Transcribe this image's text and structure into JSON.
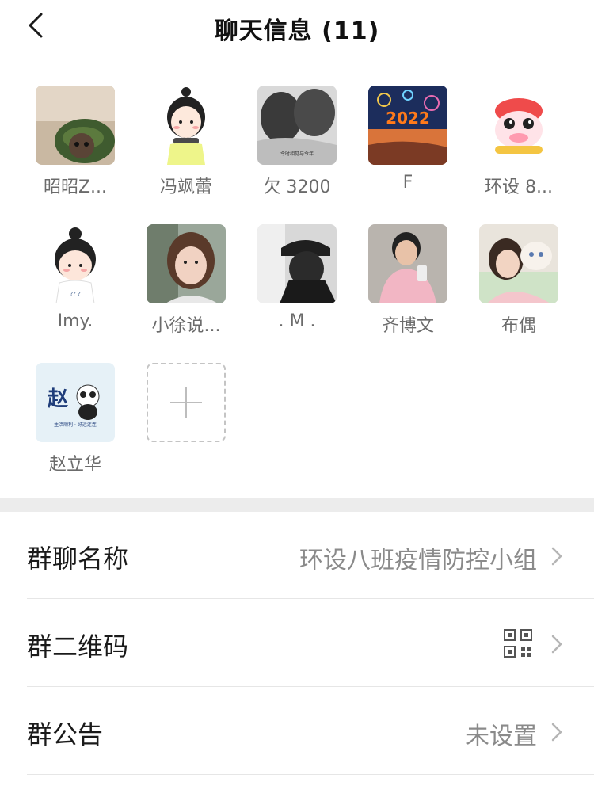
{
  "header": {
    "title": "聊天信息 (11)"
  },
  "members": [
    {
      "name": "昭昭Z...",
      "avatar": "avatar-photo-hat-cat"
    },
    {
      "name": "冯飒蕾",
      "avatar": "avatar-cartoon-girl-scarf"
    },
    {
      "name": "欠 3200",
      "avatar": "avatar-bw-kiss-photo"
    },
    {
      "name": "F",
      "avatar": "avatar-2022-fireworks"
    },
    {
      "name": "环设 8...",
      "avatar": "avatar-lion-dance-cartoon"
    },
    {
      "name": "Imy.",
      "avatar": "avatar-cartoon-girl-bun"
    },
    {
      "name": "小徐说...",
      "avatar": "avatar-girl-photo"
    },
    {
      "name": ". M .",
      "avatar": "avatar-dark-cap-photo"
    },
    {
      "name": "齐博文",
      "avatar": "avatar-man-pink-hoodie"
    },
    {
      "name": "布偶",
      "avatar": "avatar-girl-with-cat"
    },
    {
      "name": "赵立华",
      "avatar": "avatar-zhao-panda"
    }
  ],
  "avatar_texts": {
    "kiss_caption": "今时相见与今年",
    "year": "2022",
    "zhao_char": "赵",
    "zhao_caption": "生活顺利 · 好运连连",
    "lmy_shirt": "?? ?"
  },
  "settings": [
    {
      "label": "群聊名称",
      "value": "环设八班疫情防控小组"
    },
    {
      "label": "群二维码",
      "value": ""
    },
    {
      "label": "群公告",
      "value": "未设置"
    }
  ],
  "icons": {
    "back": "chevron-left-icon",
    "add": "plus-icon",
    "qr": "qr-code-icon",
    "chevron": "chevron-right-icon"
  }
}
